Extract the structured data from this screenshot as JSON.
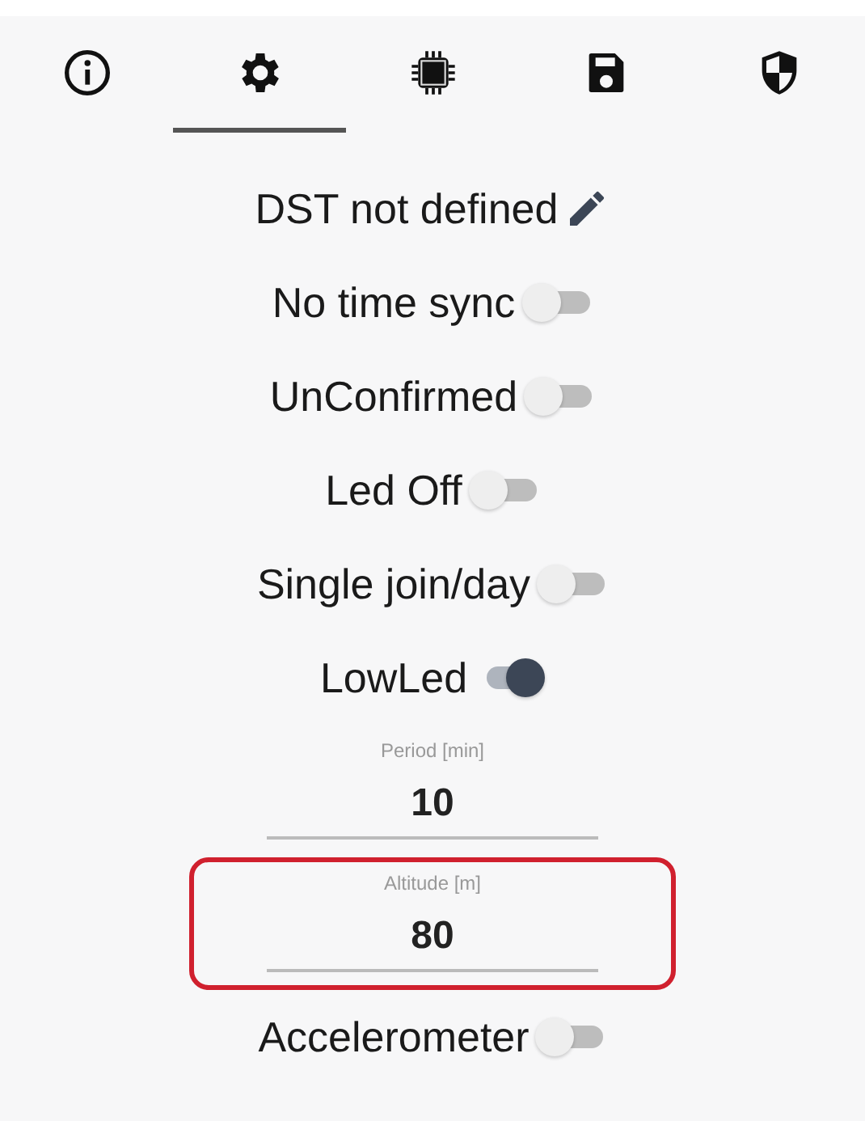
{
  "tabs": [
    {
      "kind": "info",
      "selected": false
    },
    {
      "kind": "settings",
      "selected": true
    },
    {
      "kind": "chip",
      "selected": false
    },
    {
      "kind": "save",
      "selected": false
    },
    {
      "kind": "shield",
      "selected": false
    }
  ],
  "items": [
    {
      "kind": "edit",
      "label": "DST not defined"
    },
    {
      "kind": "toggle",
      "label": "No time sync",
      "on": false
    },
    {
      "kind": "toggle",
      "label": "UnConfirmed",
      "on": false
    },
    {
      "kind": "toggle",
      "label": "Led Off",
      "on": false
    },
    {
      "kind": "toggle",
      "label": "Single join/day",
      "on": false
    },
    {
      "kind": "toggle",
      "label": "LowLed",
      "on": true
    },
    {
      "kind": "field",
      "label": "Period [min]",
      "value": "10",
      "highlighted": false
    },
    {
      "kind": "field",
      "label": "Altitude [m]",
      "value": "80",
      "highlighted": true
    },
    {
      "kind": "toggle",
      "label": "Accelerometer",
      "on": false
    }
  ]
}
